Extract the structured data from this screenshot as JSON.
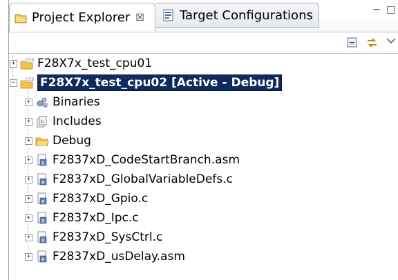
{
  "tabs": [
    {
      "label": "Project Explorer",
      "icon": "project-explorer-icon",
      "close": "☒"
    },
    {
      "label": "Target Configurations",
      "icon": "target-config-icon"
    }
  ],
  "window_controls": {
    "minimize": "−",
    "maximize": "□"
  },
  "toolbar": {
    "collapse_icon": "collapse-all-icon",
    "link_icon": "link-with-editor-icon",
    "menu_icon": "view-menu-icon"
  },
  "tree": {
    "projects": [
      {
        "label": "F28X7x_test_cpu01",
        "expanded": false,
        "selected": false
      },
      {
        "label": "F28X7x_test_cpu02  [Active - Debug]",
        "expanded": true,
        "selected": true
      }
    ],
    "children": [
      {
        "label": "Binaries",
        "icon": "binaries-icon"
      },
      {
        "label": "Includes",
        "icon": "includes-icon"
      },
      {
        "label": "Debug",
        "icon": "folder-icon"
      },
      {
        "label": "F2837xD_CodeStartBranch.asm",
        "icon": "source-file-icon"
      },
      {
        "label": "F2837xD_GlobalVariableDefs.c",
        "icon": "source-file-icon"
      },
      {
        "label": "F2837xD_Gpio.c",
        "icon": "source-file-icon"
      },
      {
        "label": "F2837xD_Ipc.c",
        "icon": "source-file-icon"
      },
      {
        "label": "F2837xD_SysCtrl.c",
        "icon": "source-file-icon"
      },
      {
        "label": "F2837xD_usDelay.asm",
        "icon": "source-file-icon"
      }
    ]
  },
  "colors": {
    "selection": "#0f2a5c",
    "folder": "#f0c44c"
  }
}
